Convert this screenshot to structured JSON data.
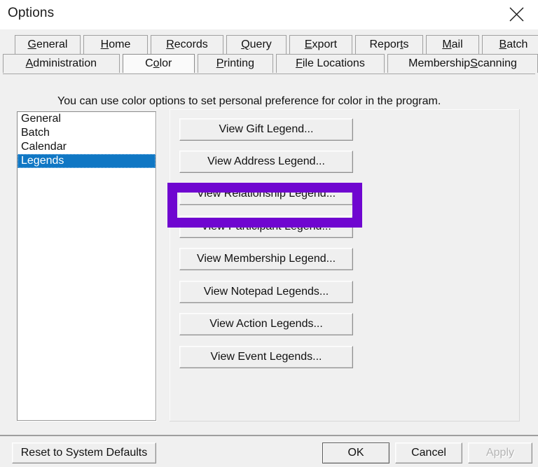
{
  "window": {
    "title": "Options",
    "close_icon": "close-icon"
  },
  "tabs": {
    "row1": [
      {
        "label": "General",
        "accel": "G",
        "selected": false
      },
      {
        "label": "Home",
        "accel": "H",
        "selected": false
      },
      {
        "label": "Records",
        "accel": "R",
        "selected": false
      },
      {
        "label": "Query",
        "accel": "Q",
        "selected": false
      },
      {
        "label": "Export",
        "accel": "E",
        "selected": false
      },
      {
        "label": "Reports",
        "accel": "t",
        "selected": false
      },
      {
        "label": "Mail",
        "accel": "M",
        "selected": false
      },
      {
        "label": "Batch",
        "accel": "B",
        "selected": false
      }
    ],
    "row2": [
      {
        "label": "Administration",
        "accel": "A",
        "selected": false
      },
      {
        "label": "Color",
        "accel": "o",
        "selected": true
      },
      {
        "label": "Printing",
        "accel": "P",
        "selected": false
      },
      {
        "label": "File Locations",
        "accel": "F",
        "selected": false
      },
      {
        "label": "Membership Scanning",
        "accel": "S",
        "selected": false
      }
    ]
  },
  "main": {
    "description": "You can use color options to set personal preference for color in the program.",
    "category_list": {
      "items": [
        {
          "label": "General",
          "selected": false
        },
        {
          "label": "Batch",
          "selected": false
        },
        {
          "label": "Calendar",
          "selected": false
        },
        {
          "label": "Legends",
          "selected": true
        }
      ]
    },
    "legend_buttons": [
      {
        "label": "View Gift Legend...",
        "highlighted": true
      },
      {
        "label": "View Address Legend...",
        "highlighted": false
      },
      {
        "label": "View Relationship Legend...",
        "highlighted": false
      },
      {
        "label": "View Participant Legend...",
        "highlighted": false
      },
      {
        "label": "View Membership Legend...",
        "highlighted": false
      },
      {
        "label": "View Notepad Legends...",
        "highlighted": false
      },
      {
        "label": "View Action Legends...",
        "highlighted": false
      },
      {
        "label": "View Event Legends...",
        "highlighted": false
      }
    ]
  },
  "footer": {
    "reset_label": "Reset to System Defaults",
    "ok_label": "OK",
    "cancel_label": "Cancel",
    "apply_label": "Apply",
    "apply_enabled": false
  },
  "annotation": {
    "highlight_color": "#6f06d0",
    "target": "View Gift Legend..."
  },
  "colors": {
    "window_bg": "#f0f0f0",
    "titlebar_bg": "#ffffff",
    "selection_blue": "#1077c4",
    "text": "#111111",
    "disabled_text": "#b4b4b4"
  }
}
